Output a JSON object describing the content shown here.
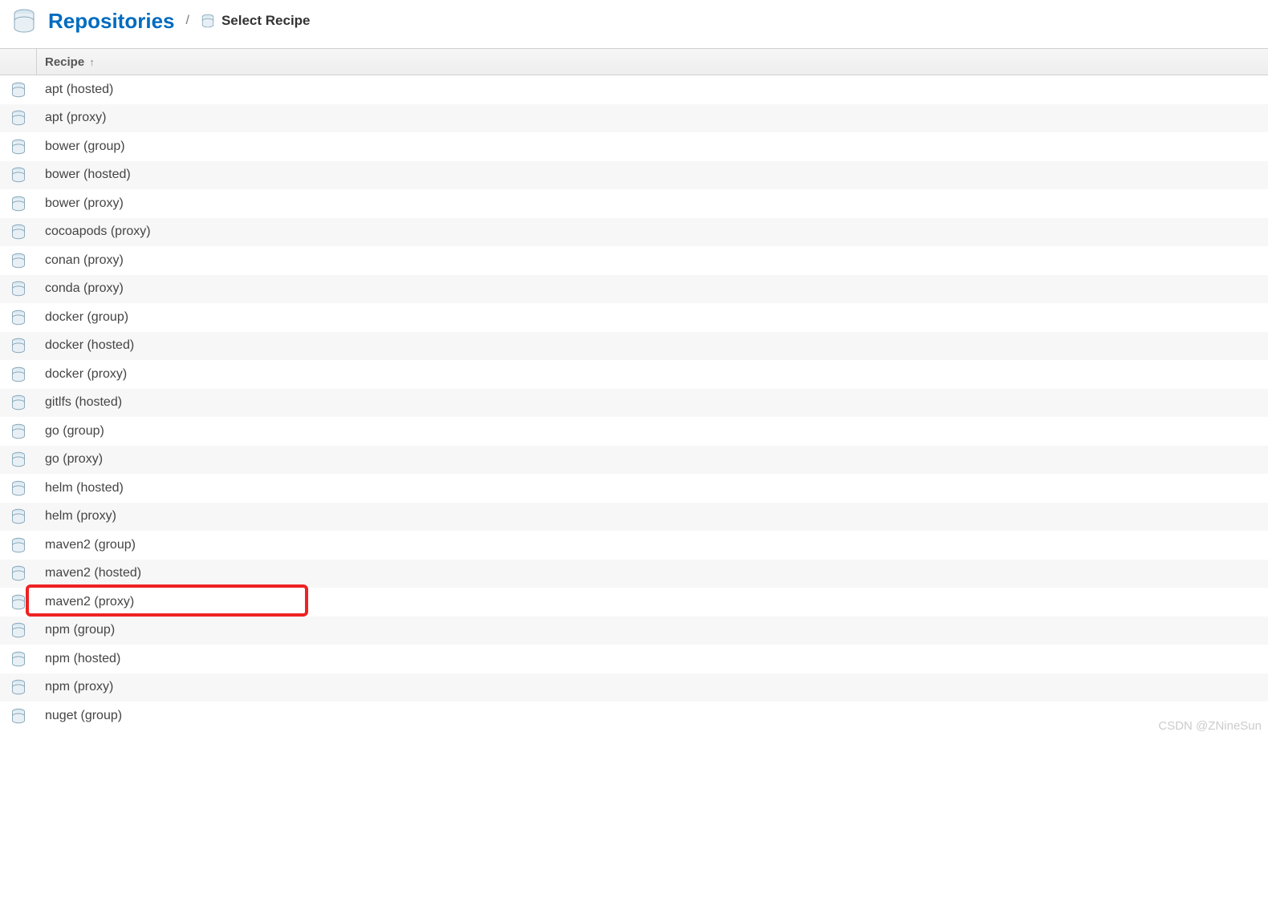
{
  "header": {
    "title": "Repositories",
    "separator": "/",
    "current": "Select Recipe"
  },
  "table": {
    "column_header": "Recipe",
    "sort_indicator": "↑"
  },
  "recipes": [
    "apt (hosted)",
    "apt (proxy)",
    "bower (group)",
    "bower (hosted)",
    "bower (proxy)",
    "cocoapods (proxy)",
    "conan (proxy)",
    "conda (proxy)",
    "docker (group)",
    "docker (hosted)",
    "docker (proxy)",
    "gitlfs (hosted)",
    "go (group)",
    "go (proxy)",
    "helm (hosted)",
    "helm (proxy)",
    "maven2 (group)",
    "maven2 (hosted)",
    "maven2 (proxy)",
    "npm (group)",
    "npm (hosted)",
    "npm (proxy)",
    "nuget (group)"
  ],
  "highlighted_index": 18,
  "watermark": "CSDN @ZNineSun"
}
